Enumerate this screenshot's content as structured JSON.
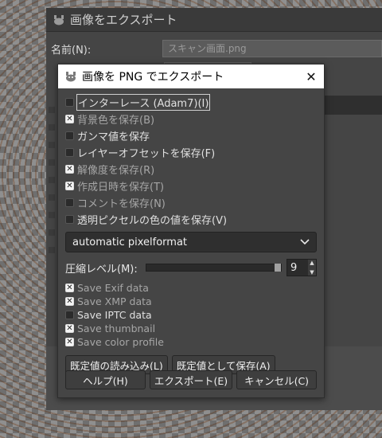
{
  "background_window": {
    "title": "画像をエクスポート",
    "name_label": "名前(N):",
    "name_value": "スキャン画面.png"
  },
  "dialog": {
    "title": "画像を PNG でエクスポート",
    "close_label": "✕",
    "options": [
      {
        "label": "インターレース (Adam7)(I)",
        "checked": false,
        "dim": false
      },
      {
        "label": "背景色を保存(B)",
        "checked": true,
        "dim": true
      },
      {
        "label": "ガンマ値を保存",
        "checked": false,
        "dim": false
      },
      {
        "label": "レイヤーオフセットを保存(F)",
        "checked": false,
        "dim": false
      },
      {
        "label": "解像度を保存(R)",
        "checked": true,
        "dim": true
      },
      {
        "label": "作成日時を保存(T)",
        "checked": true,
        "dim": true
      },
      {
        "label": "コメントを保存(N)",
        "checked": false,
        "dim": true
      },
      {
        "label": "透明ピクセルの色の値を保存(V)",
        "checked": false,
        "dim": false
      }
    ],
    "pixelformat": "automatic pixelformat",
    "compression": {
      "label": "圧縮レベル(M):",
      "value": "9",
      "level_fraction": 1.0
    },
    "metadata": [
      {
        "label": "Save Exif data",
        "checked": true,
        "dim": true
      },
      {
        "label": "Save XMP data",
        "checked": true,
        "dim": true
      },
      {
        "label": "Save IPTC data",
        "checked": false,
        "dim": false
      },
      {
        "label": "Save thumbnail",
        "checked": true,
        "dim": true
      },
      {
        "label": "Save color profile",
        "checked": true,
        "dim": true
      }
    ],
    "defaults_buttons": {
      "load": "既定値の読み込み(L)",
      "save": "既定値として保存(A)"
    },
    "footer_buttons": {
      "help": "ヘルプ(H)",
      "export": "エクスポート(E)",
      "cancel": "キャンセル(C)"
    }
  }
}
